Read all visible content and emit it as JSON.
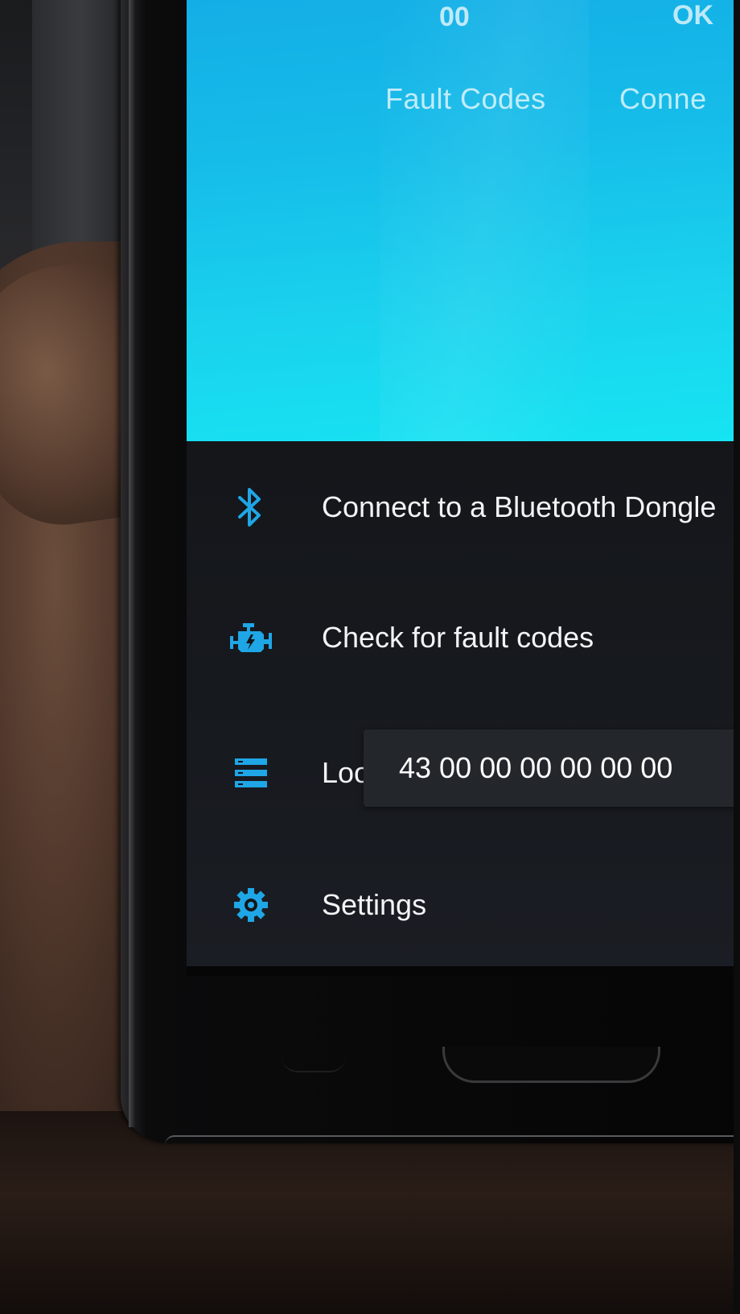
{
  "header": {
    "stats": [
      {
        "value": "00",
        "label": "Fault Codes"
      },
      {
        "value": "OK",
        "label": "Conne"
      }
    ]
  },
  "menu": {
    "items": [
      {
        "label": "Connect to a Bluetooth Dongle",
        "icon": "bluetooth-icon"
      },
      {
        "label": "Check for fault codes",
        "icon": "engine-icon"
      },
      {
        "label": "Loo",
        "icon": "list-icon"
      },
      {
        "label": "Settings",
        "icon": "gear-icon"
      }
    ]
  },
  "toast": {
    "text": "43 00 00 00 00 00 00"
  },
  "colors": {
    "header_gradient_start": "#13aee6",
    "header_gradient_end": "#16e4f2",
    "icon_accent": "#1fa6e6",
    "menu_background": "#14161a",
    "menu_text": "#f2f4f6"
  }
}
